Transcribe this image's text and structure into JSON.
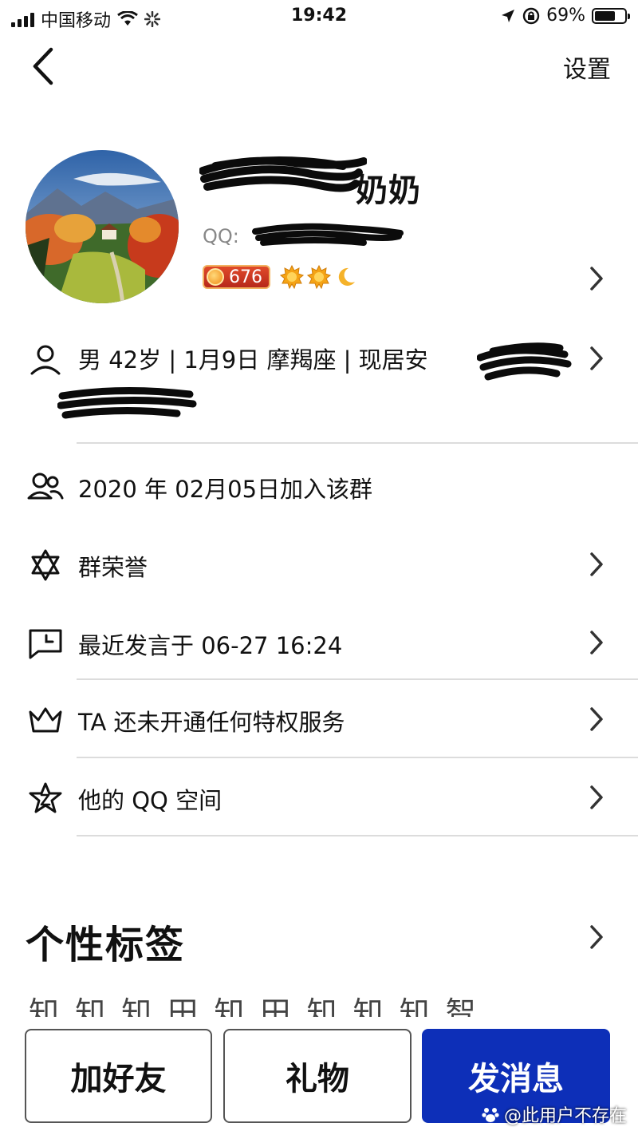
{
  "status_bar": {
    "carrier": "中国移动",
    "time": "19:42",
    "battery_percent": "69%",
    "battery_level": 0.69
  },
  "nav": {
    "settings_label": "设置"
  },
  "profile": {
    "nickname": "奶奶",
    "qq_label": "QQ:",
    "level_value": "676"
  },
  "info": {
    "basic": "男 42岁 | 1月9日 摩羯座 | 现居安",
    "joined": "2020 年 02月05日加入该群",
    "honor": "群荣誉",
    "last_speak": "最近发言于 06-27 16:24",
    "privilege": "TA 还未开通任何特权服务",
    "qzone": "他的 QQ 空间"
  },
  "tags": {
    "title": "个性标签",
    "preview": "知 知 知 田 知 田 知 知 知 智"
  },
  "actions": {
    "add_friend": "加好友",
    "gift": "礼物",
    "send_message": "发消息"
  },
  "watermark": "@此用户不存在",
  "colors": {
    "primary_button": "#0d2fb8",
    "level_badge": "#c8321e",
    "divider": "#dcdcdc"
  }
}
